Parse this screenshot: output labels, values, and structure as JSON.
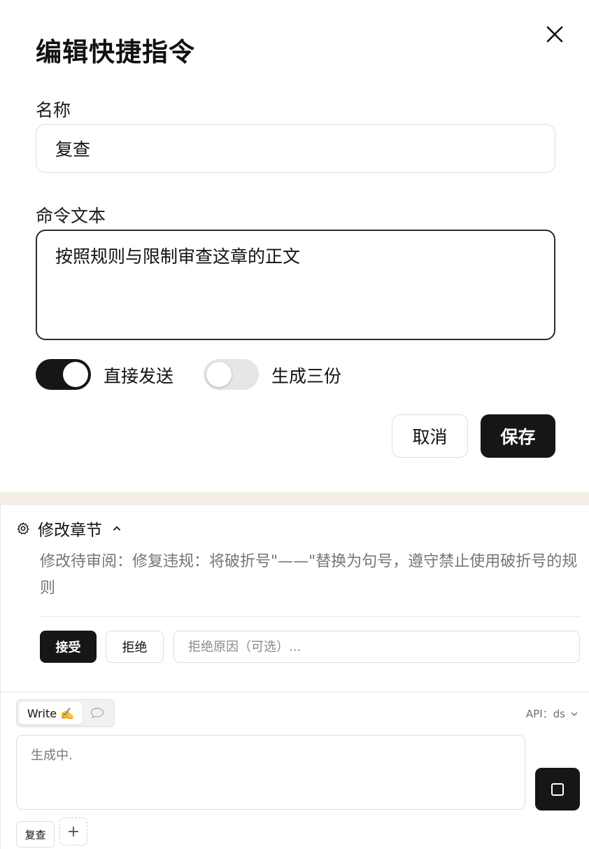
{
  "dialog": {
    "title": "编辑快捷指令",
    "name_label": "名称",
    "name_value": "复查",
    "command_label": "命令文本",
    "command_value": "按照规则与限制审查这章的正文",
    "toggles": [
      {
        "label": "直接发送",
        "on": true
      },
      {
        "label": "生成三份",
        "on": false
      }
    ],
    "cancel_label": "取消",
    "save_label": "保存"
  },
  "panel": {
    "section_title": "修改章节",
    "pending_text": "修改待审阅：修复违规：将破折号\"——\"替换为句号，遵守禁止使用破折号的规则",
    "accept_label": "接受",
    "reject_label": "拒绝",
    "reason_placeholder": "拒绝原因（可选）...",
    "mode_write_label": "Write ✍️",
    "api_label": "API：ds",
    "generating_text": "生成中.",
    "shortcut_chip": "复查",
    "add_chip": "+"
  },
  "colors": {
    "accent": "#161616",
    "band": "#f4efe6",
    "muted_text": "#767676"
  },
  "icons": [
    "close-icon",
    "gear-icon",
    "chevron-up-icon",
    "chat-bubble-icon",
    "chevron-down-icon",
    "stop-icon",
    "plus-icon"
  ]
}
